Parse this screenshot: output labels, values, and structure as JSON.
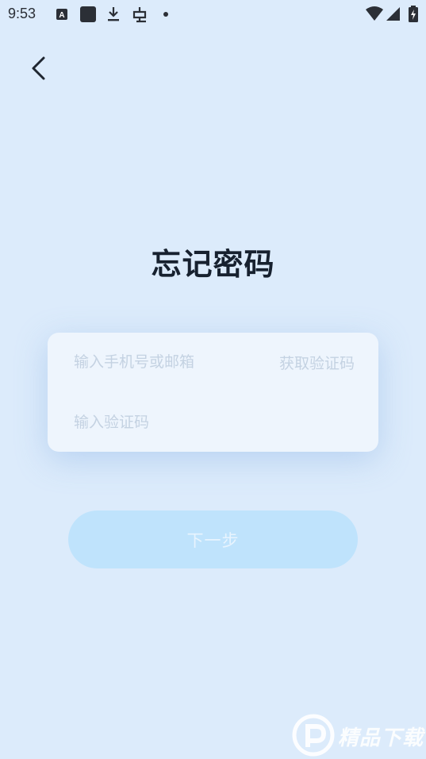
{
  "status_bar": {
    "time": "9:53",
    "icons": [
      "a-box-icon",
      "square-icon",
      "download-icon",
      "bug-icon",
      "dot-icon",
      "wifi-icon",
      "signal-icon",
      "battery-charging-icon"
    ]
  },
  "header": {
    "back_icon": "chevron-left-icon"
  },
  "title": "忘记密码",
  "form": {
    "phone_placeholder": "输入手机号或邮箱",
    "get_code_label": "获取验证码",
    "code_placeholder": "输入验证码"
  },
  "next_button": {
    "label": "下一步"
  },
  "watermark": {
    "text": "精品下载"
  },
  "colors": {
    "background": "#dcebfb",
    "card": "#eef5fd",
    "button": "#bfe3fc",
    "placeholder": "#c4d2e2",
    "title": "#17212f"
  }
}
